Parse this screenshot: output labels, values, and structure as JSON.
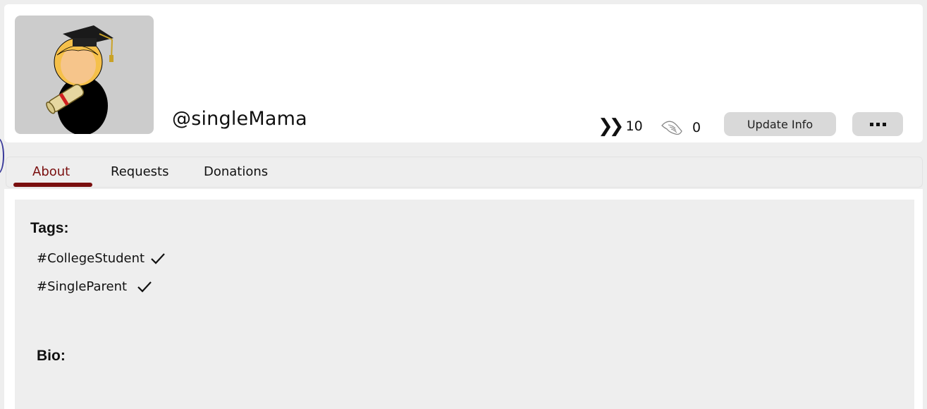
{
  "profile": {
    "username": "@singleMama",
    "avatar_icon": "graduate-avatar-icon"
  },
  "stats": {
    "followers_icon": "double-chevron-icon",
    "followers_count": "10",
    "hands_icon": "praying-hands-icon",
    "hands_count": "0"
  },
  "actions": {
    "update_label": "Update Info",
    "more_icon": "more-dots-icon"
  },
  "tabs": [
    {
      "label": "About",
      "active": true
    },
    {
      "label": "Requests",
      "active": false
    },
    {
      "label": "Donations",
      "active": false
    }
  ],
  "about": {
    "tags_heading": "Tags:",
    "tags": [
      "#CollegeStudent",
      "#SingleParent"
    ],
    "bio_heading": "Bio:"
  },
  "colors": {
    "accent": "#7a0f0f",
    "button": "#d9d9d9",
    "panel": "#eeeeee"
  }
}
